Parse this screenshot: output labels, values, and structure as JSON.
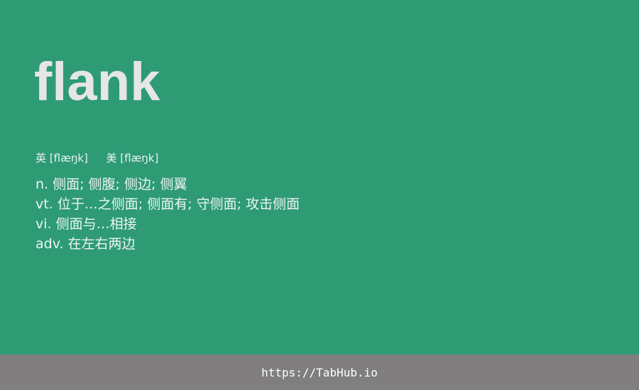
{
  "entry": {
    "word": "flank",
    "phonetics": {
      "uk_label": "英",
      "uk_ipa": "[flæŋk]",
      "us_label": "美",
      "us_ipa": "[flæŋk]"
    },
    "definitions": [
      "n. 侧面; 侧腹; 侧边; 侧翼",
      "vt. 位于…之侧面; 侧面有; 守侧面; 攻击侧面",
      "vi. 侧面与…相接",
      "adv. 在左右两边"
    ]
  },
  "footer": {
    "link": "https://TabHub.io"
  },
  "colors": {
    "background": "#2e9b75",
    "footer": "#807e7e",
    "word": "#e6e6e6"
  }
}
